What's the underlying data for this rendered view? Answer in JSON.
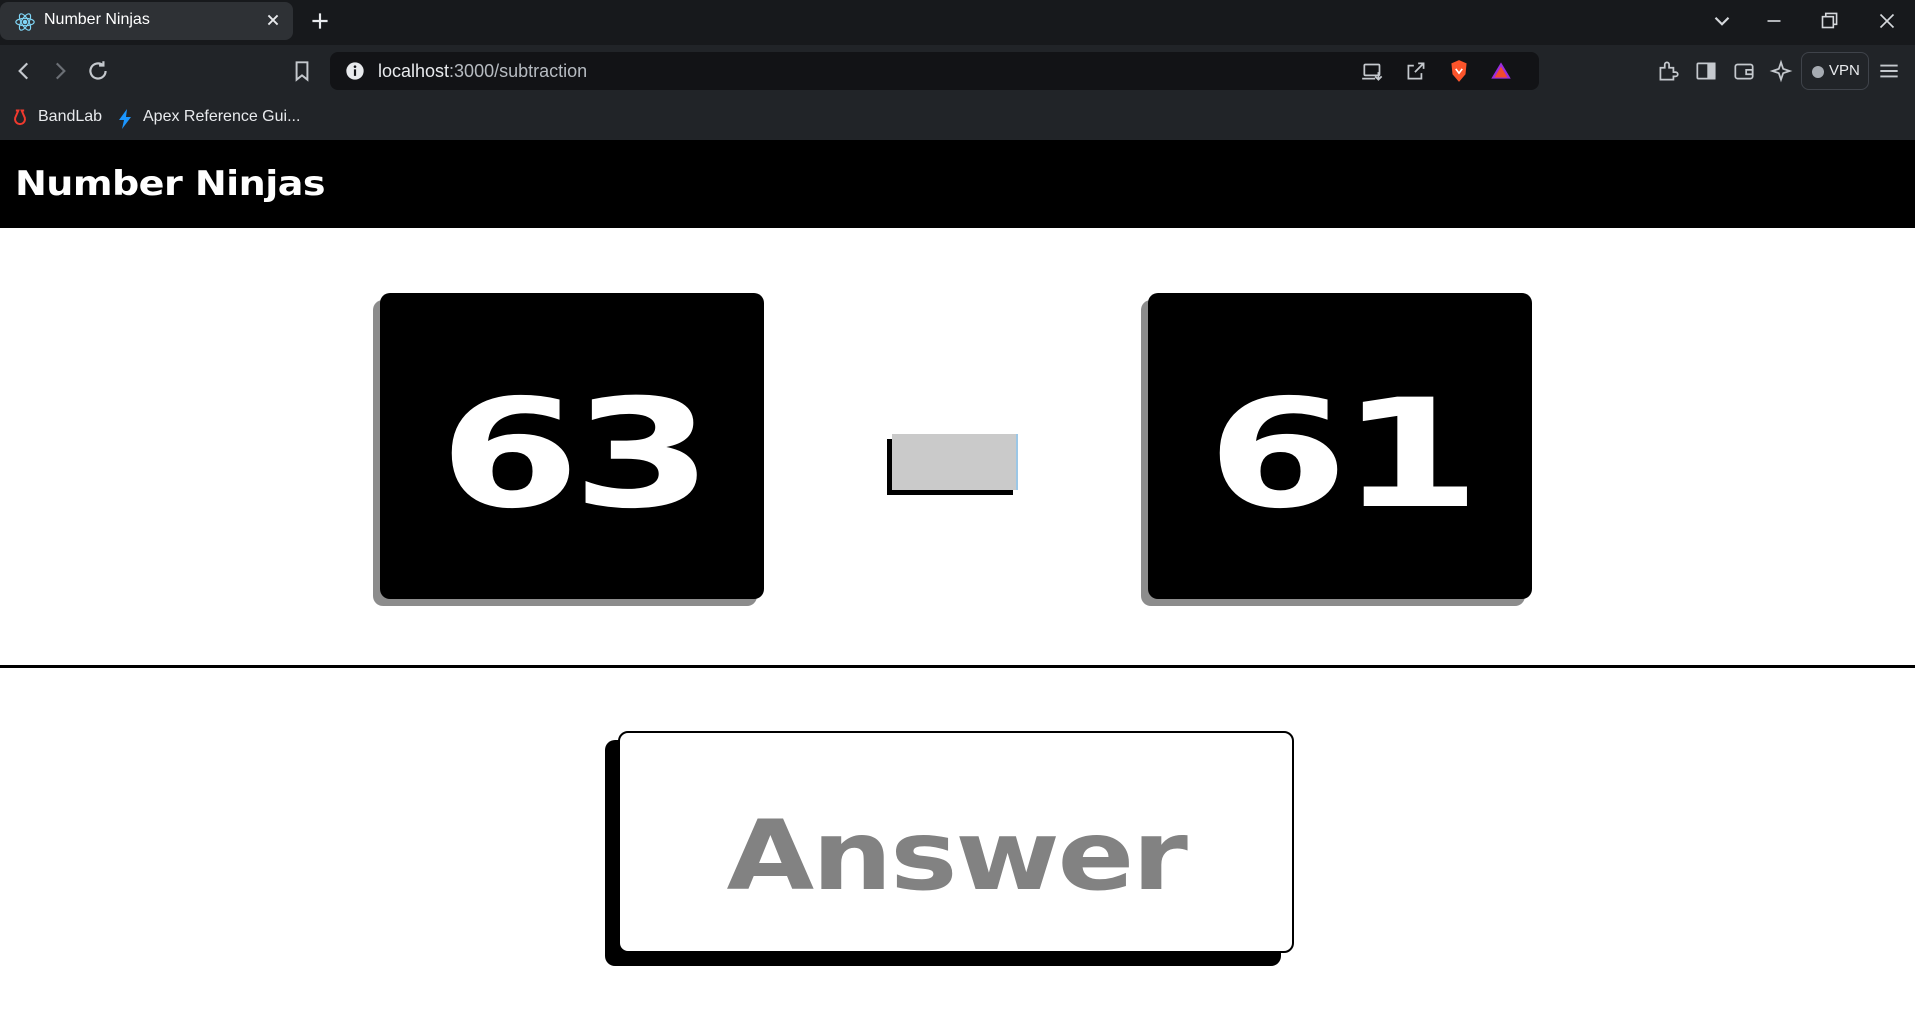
{
  "browser": {
    "tab": {
      "title": "Number Ninjas",
      "icon": "react-icon"
    },
    "address": {
      "host": "localhost",
      "path": ":3000/subtraction"
    },
    "vpn_label": "VPN",
    "bookmarks": [
      {
        "label": "BandLab",
        "icon": "bandlab-icon"
      },
      {
        "label": "Apex Reference Gui...",
        "icon": "lightning-icon"
      }
    ]
  },
  "app": {
    "title": "Number Ninjas",
    "problem": {
      "first_number": "63",
      "second_number": "61"
    },
    "answer_label": "Answer"
  },
  "colors": {
    "header_bg": "#000000",
    "card_bg": "#000000",
    "card_shadow": "#8c8c8c",
    "operator_fill": "#cacaca",
    "answer_text": "#828282"
  }
}
